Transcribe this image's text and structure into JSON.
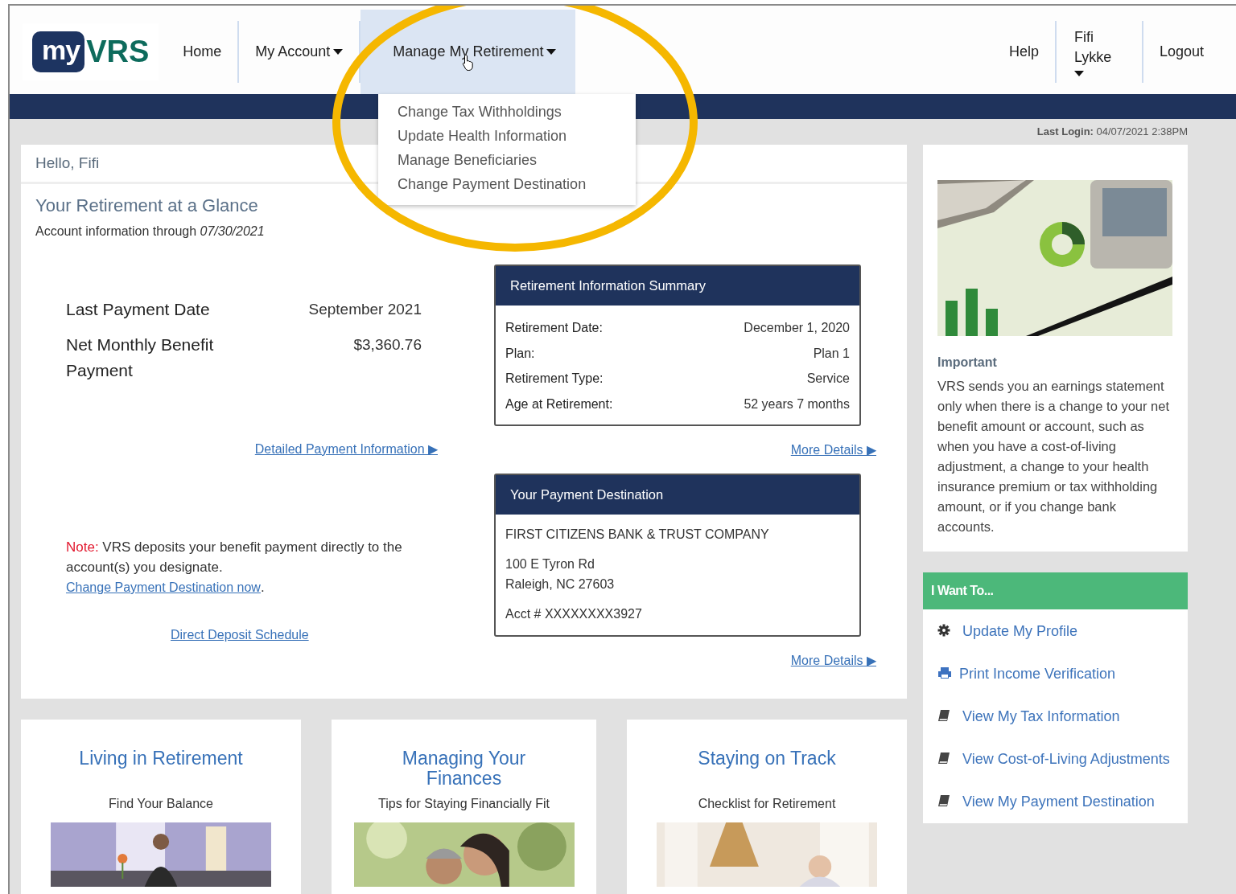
{
  "header": {
    "logo": {
      "my": "my",
      "vrs": "VRS"
    },
    "nav": [
      {
        "label": "Home",
        "dropdown": false,
        "selected": false
      },
      {
        "label": "My Account",
        "dropdown": true,
        "selected": false
      },
      {
        "label": "Manage My Retirement",
        "dropdown": true,
        "selected": true
      }
    ],
    "user_nav": [
      {
        "label": "Help",
        "dropdown": false
      },
      {
        "label": "Fifi Lykke",
        "dropdown": true
      },
      {
        "label": "Logout",
        "dropdown": false
      }
    ]
  },
  "dropdown_menu": [
    "Change Tax Withholdings",
    "Update Health Information",
    "Manage Beneficiaries",
    "Change Payment Destination"
  ],
  "last_login": {
    "label": "Last Login:",
    "value": "04/07/2021 2:38PM"
  },
  "greeting": "Hello, Fifi",
  "glance": {
    "title": "Your Retirement at a Glance",
    "through_label": "Account information through",
    "through_date": "07/30/2021"
  },
  "payment": [
    {
      "label": "Last Payment Date",
      "value": "September 2021"
    },
    {
      "label": "Net Monthly Benefit Payment",
      "value": "$3,360.76"
    }
  ],
  "payment_link": "Detailed Payment Information ▶",
  "note": {
    "label": "Note:",
    "text": "VRS deposits your benefit payment directly to the account(s) you designate.",
    "link": "Change Payment Destination now",
    "after": "."
  },
  "schedule_link": "Direct Deposit Schedule",
  "summary": {
    "title": "Retirement Information Summary",
    "rows": [
      {
        "label": "Retirement Date:",
        "value": "December 1, 2020"
      },
      {
        "label": "Plan:",
        "value": "Plan 1"
      },
      {
        "label": "Retirement Type:",
        "value": "Service"
      },
      {
        "label": "Age at Retirement:",
        "value": "52 years 7 months"
      }
    ],
    "link": "More Details ▶"
  },
  "destination": {
    "title": "Your Payment Destination",
    "bank": "FIRST CITIZENS BANK & TRUST COMPANY",
    "address": [
      "100 E Tyron Rd",
      "Raleigh, NC 27603"
    ],
    "account": "Acct # XXXXXXXX3927",
    "link": "More Details ▶"
  },
  "important": {
    "title": "Important",
    "text": "VRS sends you an earnings statement only when there is a change to your net benefit amount or account, such as when you have a cost-of-living adjustment, a change to your health insurance premium or tax withholding amount, or if you change bank accounts."
  },
  "want_to": {
    "title": "I Want To...",
    "items": [
      {
        "label": "Update My Profile",
        "kind": "gear"
      },
      {
        "label": "Print Income Verification",
        "kind": "printer"
      },
      {
        "label": "View My Tax Information",
        "kind": "book"
      },
      {
        "label": "View Cost-of-Living Adjustments",
        "kind": "book"
      },
      {
        "label": "View My Payment Destination",
        "kind": "book"
      }
    ]
  },
  "features": [
    {
      "title": "Living in Retirement",
      "subtitle": "Find Your Balance"
    },
    {
      "title": "Managing Your Finances",
      "subtitle": "Tips for Staying Financially Fit"
    },
    {
      "title": "Staying on Track",
      "subtitle": "Checklist for Retirement"
    }
  ]
}
